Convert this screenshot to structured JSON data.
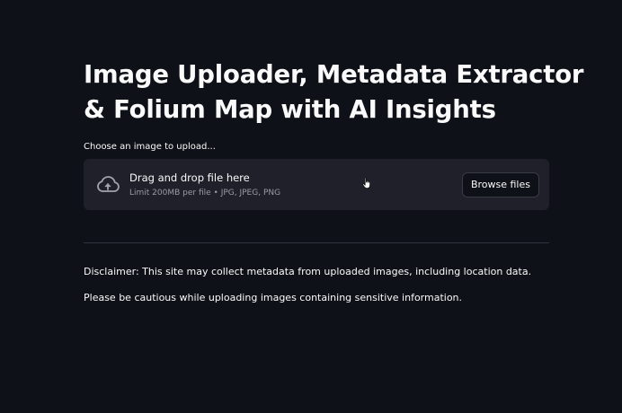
{
  "title": {
    "line1": "Image Uploader, Metadata Extractor",
    "line2": "& Folium Map with AI Insights"
  },
  "uploader": {
    "label": "Choose an image to upload...",
    "icon": "cloud-upload-icon",
    "dropzone_text": "Drag and drop file here",
    "limit_text": "Limit 200MB per file • JPG, JPEG, PNG",
    "browse_label": "Browse files"
  },
  "disclaimer": {
    "line1": "Disclaimer: This site may collect metadata from uploaded images, including location data.",
    "line2": "Please be cautious while uploading images containing sensitive information."
  },
  "colors": {
    "background": "#0e1117",
    "dropzone": "#1f2029",
    "text": "#fafafa",
    "muted": "#9a9ba3"
  }
}
